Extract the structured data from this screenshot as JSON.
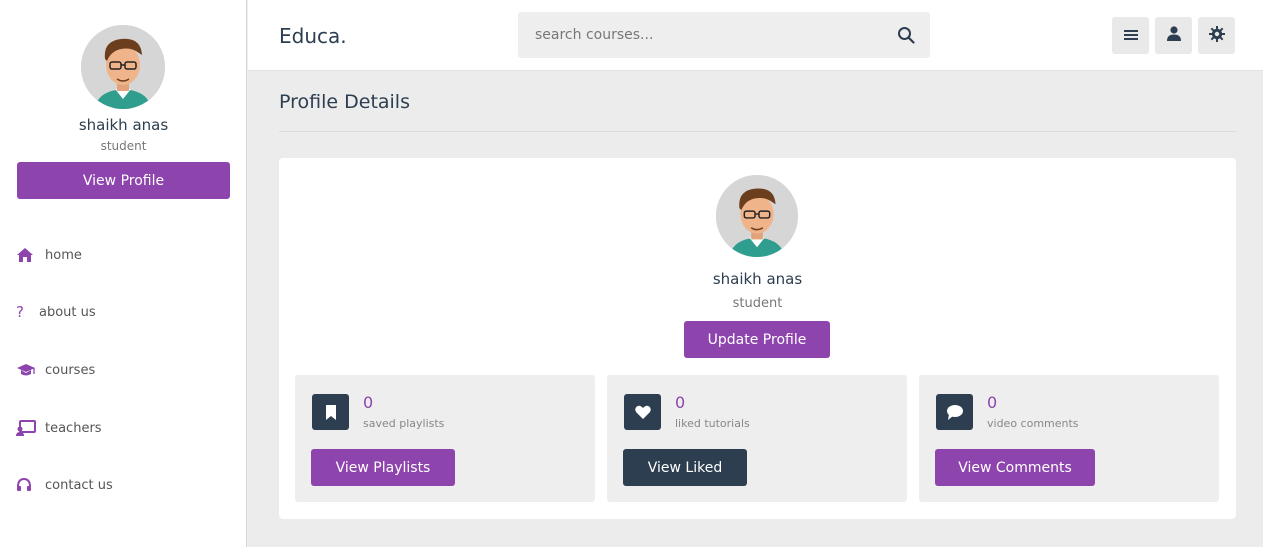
{
  "sidebar": {
    "user_name": "shaikh anas",
    "user_role": "student",
    "view_profile_label": "View Profile",
    "nav": [
      {
        "label": "home",
        "icon": "home-icon"
      },
      {
        "label": "about us",
        "icon": "question-icon"
      },
      {
        "label": "courses",
        "icon": "graduation-cap-icon"
      },
      {
        "label": "teachers",
        "icon": "chalkboard-teacher-icon"
      },
      {
        "label": "contact us",
        "icon": "headset-icon"
      }
    ]
  },
  "header": {
    "logo": "Educa.",
    "search_placeholder": "search courses...",
    "buttons": [
      "menu-icon",
      "user-icon",
      "settings-icon"
    ]
  },
  "main": {
    "title": "Profile Details",
    "profile": {
      "name": "shaikh anas",
      "role": "student",
      "update_label": "Update Profile"
    },
    "stats": [
      {
        "count": "0",
        "label": "saved playlists",
        "button": "View Playlists",
        "icon": "bookmark-icon"
      },
      {
        "count": "0",
        "label": "liked tutorials",
        "button": "View Liked",
        "icon": "heart-icon"
      },
      {
        "count": "0",
        "label": "video comments",
        "button": "View Comments",
        "icon": "comment-icon"
      }
    ]
  },
  "colors": {
    "accent": "#8e44ad",
    "dark": "#2c3e50",
    "background": "#ececec"
  }
}
